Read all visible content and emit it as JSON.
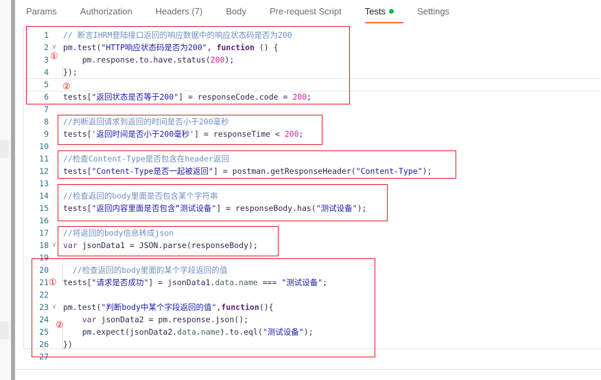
{
  "tabs": [
    {
      "label": "Params"
    },
    {
      "label": "Authorization"
    },
    {
      "label": "Headers (7)"
    },
    {
      "label": "Body"
    },
    {
      "label": "Pre-request Script"
    },
    {
      "label": "Tests",
      "active": true,
      "status_dot": "#0cbb52"
    },
    {
      "label": "Settings"
    }
  ],
  "annotations": {
    "one": "①",
    "two": "②"
  },
  "code": [
    {
      "n": "1",
      "tokens": [
        [
          "comment",
          "// 断言IHRM登陆接口返回的响应数据中的响应状态码是否为200"
        ]
      ]
    },
    {
      "n": "2",
      "fold": true,
      "tokens": [
        [
          "plain",
          "pm.test("
        ],
        [
          "str",
          "\"HTTP响应状态码是否为200\""
        ],
        [
          "plain",
          ", "
        ],
        [
          "kw",
          "function"
        ],
        [
          "plain",
          " () {"
        ]
      ]
    },
    {
      "n": "3",
      "tokens": [
        [
          "plain",
          "    pm.response.to.have.status("
        ],
        [
          "num",
          "200"
        ],
        [
          "plain",
          ");"
        ]
      ]
    },
    {
      "n": "4",
      "tokens": [
        [
          "plain",
          "});"
        ]
      ]
    },
    {
      "n": "5",
      "active": true,
      "tokens": []
    },
    {
      "n": "6",
      "tokens": [
        [
          "plain",
          "tests["
        ],
        [
          "str",
          "\"返回状态是否等于200\""
        ],
        [
          "plain",
          "] = responseCode.code = "
        ],
        [
          "num",
          "200"
        ],
        [
          "plain",
          ";"
        ]
      ]
    },
    {
      "n": "7",
      "tokens": []
    },
    {
      "n": "8",
      "tokens": [
        [
          "comment",
          "//判断返回请求到返回的时间是否小于200毫秒"
        ]
      ]
    },
    {
      "n": "9",
      "tokens": [
        [
          "plain",
          "tests["
        ],
        [
          "str",
          "'返回时间是否小于200毫秒'"
        ],
        [
          "plain",
          "] = responseTime < "
        ],
        [
          "num",
          "200"
        ],
        [
          "plain",
          ";"
        ]
      ]
    },
    {
      "n": "10",
      "tokens": []
    },
    {
      "n": "11",
      "tokens": [
        [
          "comment",
          "//检查Content-Type是否包含在header返回"
        ]
      ]
    },
    {
      "n": "12",
      "tokens": [
        [
          "plain",
          "tests["
        ],
        [
          "str",
          "\"Content-Type是否一起被返回\""
        ],
        [
          "plain",
          "] = postman.getResponseHeader("
        ],
        [
          "str",
          "\"Content-Type\""
        ],
        [
          "plain",
          ");"
        ]
      ]
    },
    {
      "n": "13",
      "tokens": []
    },
    {
      "n": "14",
      "tokens": [
        [
          "comment",
          "//检查返回的body里面是否包含某个字符串"
        ]
      ]
    },
    {
      "n": "15",
      "tokens": [
        [
          "plain",
          "tests["
        ],
        [
          "str",
          "\"返回内容里面是否包含“测试设备\""
        ],
        [
          "plain",
          "] = responseBody.has("
        ],
        [
          "str",
          "\"测试设备\""
        ],
        [
          "plain",
          ");"
        ]
      ]
    },
    {
      "n": "16",
      "tokens": []
    },
    {
      "n": "17",
      "tokens": [
        [
          "comment",
          "//将返回的body信息转成json"
        ]
      ]
    },
    {
      "n": "18",
      "fold": true,
      "tokens": [
        [
          "var",
          "var"
        ],
        [
          "plain",
          " jsonData1 = JSON.parse(responseBody);"
        ]
      ]
    },
    {
      "n": "19",
      "tokens": []
    },
    {
      "n": "20",
      "tokens": [
        [
          "comment",
          "  //检查返回的body里面的某个字段返回的值"
        ]
      ]
    },
    {
      "n": "21",
      "tokens": [
        [
          "plain",
          "tests["
        ],
        [
          "str",
          "\"请求是否成功\""
        ],
        [
          "plain",
          "] = jsonData1."
        ],
        [
          "prop",
          "data"
        ],
        [
          "plain",
          "."
        ],
        [
          "prop",
          "name"
        ],
        [
          "plain",
          " === "
        ],
        [
          "str",
          "\"测试设备\""
        ],
        [
          "plain",
          ";"
        ]
      ]
    },
    {
      "n": "22",
      "tokens": []
    },
    {
      "n": "23",
      "fold": true,
      "tokens": [
        [
          "plain",
          "pm.test("
        ],
        [
          "str",
          "\"判断body中某个字段返回的值\""
        ],
        [
          "plain",
          ","
        ],
        [
          "kw",
          "function"
        ],
        [
          "plain",
          "(){"
        ]
      ]
    },
    {
      "n": "24",
      "tokens": [
        [
          "plain",
          "    "
        ],
        [
          "var",
          "var"
        ],
        [
          "plain",
          " jsonData2 = pm.response.json();"
        ]
      ]
    },
    {
      "n": "25",
      "tokens": [
        [
          "plain",
          "    pm.expect(jsonData2."
        ],
        [
          "prop",
          "data"
        ],
        [
          "plain",
          "."
        ],
        [
          "prop",
          "name"
        ],
        [
          "plain",
          ").to.eql("
        ],
        [
          "str",
          "\"测试设备\""
        ],
        [
          "plain",
          ");"
        ]
      ]
    },
    {
      "n": "26",
      "tokens": [
        [
          "plain",
          "})"
        ]
      ]
    },
    {
      "n": "27",
      "tokens": []
    }
  ]
}
